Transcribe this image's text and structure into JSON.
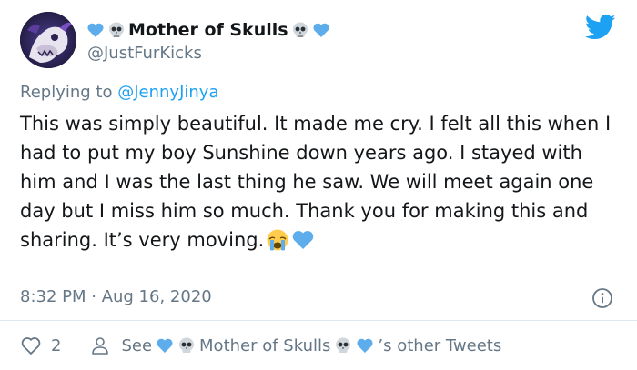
{
  "author": {
    "display_name": "Mother of Skulls",
    "handle": "@JustFurKicks"
  },
  "reply": {
    "prefix": "Replying to",
    "mention": "@JennyJinya"
  },
  "tweet": {
    "text": "This was simply beautiful. It made me cry. I felt all this when I had to put my boy Sunshine down years ago. I stayed with him and I was the last thing he saw. We will meet again one day but I miss him so much. Thank you for making this and sharing. It’s very moving."
  },
  "meta": {
    "timestamp": "8:32 PM · Aug 16, 2020"
  },
  "actions": {
    "like_count": "2",
    "see_prefix": "See",
    "see_name": "Mother of Skulls",
    "see_suffix": "’s other Tweets"
  },
  "colors": {
    "twitter_blue": "#1da1f2",
    "heart_blue": "#5dadec",
    "muted": "#657786"
  },
  "icons": [
    "twitter-bird-icon",
    "blue-heart-icon",
    "skull-icon",
    "crying-face-icon",
    "info-icon",
    "like-heart-icon",
    "person-icon"
  ]
}
